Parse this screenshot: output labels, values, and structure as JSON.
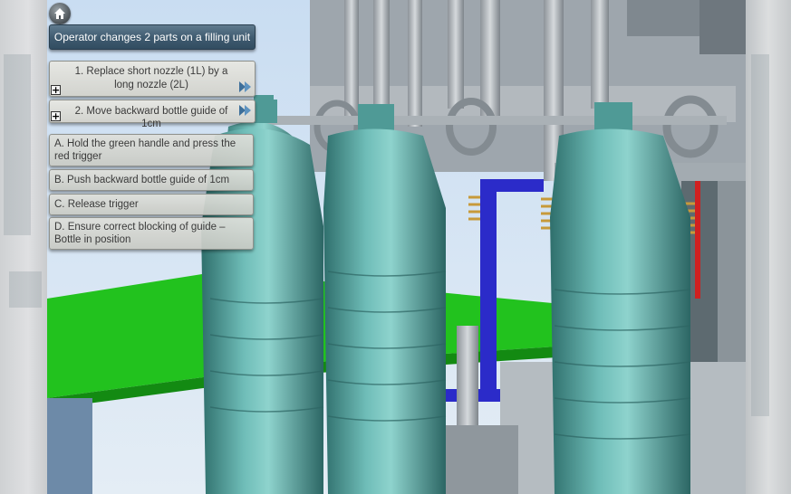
{
  "title": "Operator changes 2 parts on a filling unit",
  "steps": [
    {
      "label": "1. Replace short nozzle (1L) by a long nozzle (2L)",
      "expand_icon": "plus-icon",
      "next_icon": "double-arrow-right-icon"
    },
    {
      "label": "2. Move backward bottle guide of 1cm",
      "expand_icon": "plus-icon",
      "next_icon": "double-arrow-right-icon"
    }
  ],
  "substeps": [
    {
      "label": "A. Hold the green handle and press the red trigger"
    },
    {
      "label": "B. Push backward bottle guide of 1cm"
    },
    {
      "label": "C. Release trigger"
    },
    {
      "label": "D. Ensure correct blocking of guide – Bottle in position"
    }
  ],
  "plus_symbol": "+",
  "icons": {
    "home": "home-icon"
  },
  "colors": {
    "title_bar": "#3e5a6f",
    "panel": "#dcddd8",
    "bottle": "#5aa8a4",
    "conveyor": "#22c21e",
    "guide": "#2b2bc9",
    "trigger": "#d02020"
  }
}
